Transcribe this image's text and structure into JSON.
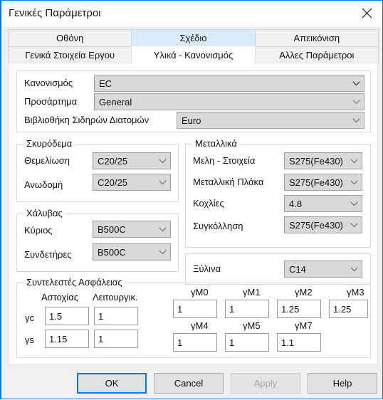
{
  "window": {
    "title": "Γενικές Παράμετροι",
    "close_icon": "close-icon"
  },
  "tabs": {
    "row1": [
      {
        "label": "Οθόνη",
        "state": "normal"
      },
      {
        "label": "Σχέδιο",
        "state": "hover"
      },
      {
        "label": "Απεικόνιση",
        "state": "normal"
      }
    ],
    "row2": [
      {
        "label": "Γενικά Στοιχεία Εργου",
        "state": "normal"
      },
      {
        "label": "Υλικά - Κανονισμός",
        "state": "selected"
      },
      {
        "label": "Αλλες Παράμετροι",
        "state": "normal"
      }
    ]
  },
  "top_section": {
    "rows": [
      {
        "label": "Κανονισμός",
        "value": "EC"
      },
      {
        "label": "Προσάρτημα",
        "value": "General"
      },
      {
        "label": "Βιβλιοθήκη Σιδηρών Διατομών",
        "value": "Euro"
      }
    ]
  },
  "concrete": {
    "title": "Σκυρόδεμα",
    "rows": [
      {
        "label": "Θεμελίωση",
        "value": "C20/25"
      },
      {
        "label": "Ανωδομή",
        "value": "C20/25"
      }
    ]
  },
  "steel_rebar": {
    "title": "Χάλυβας",
    "rows": [
      {
        "label": "Κύριος",
        "value": "B500C"
      },
      {
        "label": "Συνδετήρες",
        "value": "B500C"
      }
    ]
  },
  "metal": {
    "title": "Μεταλλικά",
    "rows": [
      {
        "label": "Μελη - Στοιχεία",
        "value": "S275(Fe430)"
      },
      {
        "label": "Μεταλλική Πλάκα",
        "value": "S275(Fe430)"
      },
      {
        "label": "Κοχλίες",
        "value": "4.8"
      },
      {
        "label": "Συγκόλληση",
        "value": "S275(Fe430)"
      }
    ]
  },
  "timber": {
    "label": "Ξύλινα",
    "value": "C14"
  },
  "safety": {
    "title": "Συντελεστές Ασφάλειας",
    "col_headers": [
      "Αστοχίας",
      "Λειτουργικ."
    ],
    "rows": [
      {
        "label": "γc",
        "ultimate": "1.5",
        "service": "1"
      },
      {
        "label": "γs",
        "ultimate": "1.15",
        "service": "1"
      }
    ],
    "gamma_m": [
      {
        "label": "γΜ0",
        "value": "1"
      },
      {
        "label": "γΜ1",
        "value": "1"
      },
      {
        "label": "γΜ2",
        "value": "1.25"
      },
      {
        "label": "γΜ3",
        "value": "1.25"
      },
      {
        "label": "γΜ4",
        "value": "1"
      },
      {
        "label": "γΜ5",
        "value": "1"
      },
      {
        "label": "γΜ7",
        "value": "1.1"
      }
    ]
  },
  "buttons": {
    "ok": "OK",
    "cancel": "Cancel",
    "apply": "Apply",
    "help": "Help"
  },
  "colors": {
    "accent": "#0078d7",
    "tab_hover": "#d8ecfb",
    "combo_bg": "#d9d9d9"
  }
}
